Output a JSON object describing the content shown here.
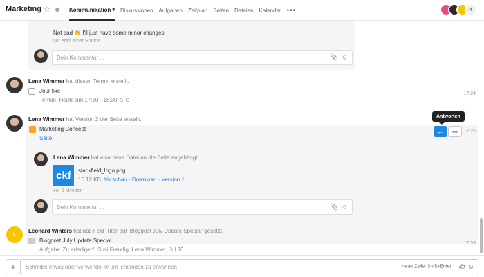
{
  "header": {
    "title": "Marketing",
    "tabs": [
      {
        "label": "Kommunikation"
      },
      {
        "label": "Diskussionen"
      },
      {
        "label": "Aufgaben"
      },
      {
        "label": "Zeitplan"
      },
      {
        "label": "Seiten"
      },
      {
        "label": "Dateien"
      },
      {
        "label": "Kalender"
      }
    ],
    "more": "•••",
    "member_count": "4"
  },
  "feed": {
    "comment1": {
      "text": "Not bad 👏 I'll just have some minor changes!",
      "time": "vor etwa einer Stunde"
    },
    "comment_placeholder": "Dein Kommentar ...",
    "event": {
      "author": "Lena Wimmer",
      "action": "hat diesen Termin erstellt.",
      "title": "Jour fixe",
      "detail": "Termin, Heute um 17:30 - 18:30",
      "time": "17:24"
    },
    "page_version": {
      "author": "Lena Wimmer",
      "action": "hat Version 2 der Seite erstellt.",
      "title": "Marketing Concept",
      "subtitle": "Seite",
      "time": "17:25",
      "tooltip": "Antworten",
      "file_author": "Lena Wimmer",
      "file_action": "hat eine neue Datei an die Seite angehängt.",
      "file_name": "stackfield_logo.png",
      "file_size": "16.12 KB,",
      "file_preview": "Vorschau",
      "file_download": "Download",
      "file_version": "Version 1",
      "file_time": "vor 9 Minuten",
      "thumb": "ckf"
    },
    "field_change": {
      "author": "Leonard Winters",
      "action": "hat das Feld 'Titel' auf 'Blogpost July Update Special' gesetzt.",
      "title": "Blogpost July Update Special",
      "detail": "Aufgabe 'Zu erledigen', Susi Freudig, Lena Wimmer, Jul 20",
      "time": "17:33",
      "initial": "L"
    }
  },
  "composer": {
    "placeholder": "Schreibe etwas oder verwende @ um jemanden zu erwähnen",
    "hint": "Neue Zeile: Shift+Enter"
  },
  "colors": {
    "accent": "#1e88e5",
    "yellow_avatar": "#f7c600"
  }
}
